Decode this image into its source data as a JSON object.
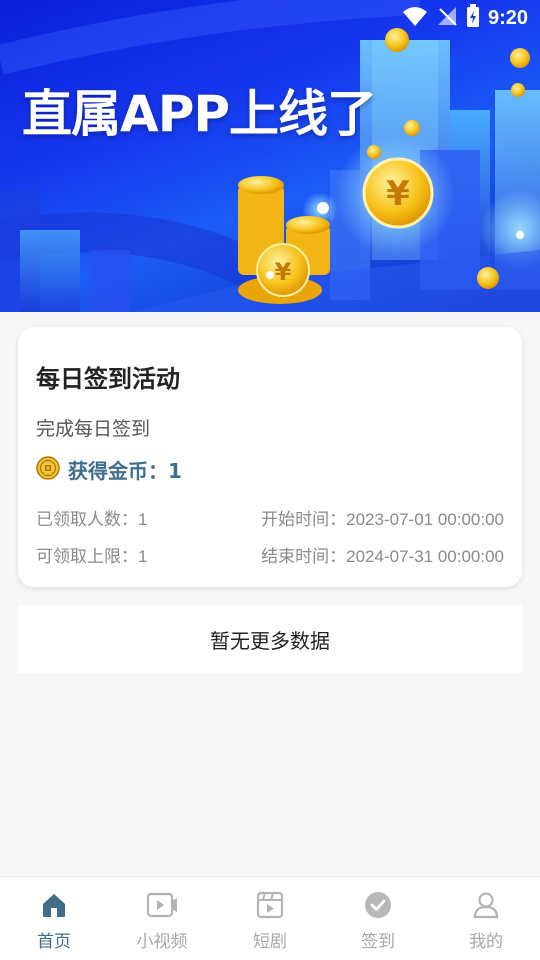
{
  "status_bar": {
    "time": "9:20"
  },
  "banner": {
    "title": "直属APP上线了"
  },
  "activity_card": {
    "title": "每日签到活动",
    "description": "完成每日签到",
    "reward": "获得金币：1",
    "claimed_count": "已领取人数：1",
    "claim_limit": "可领取上限：1",
    "start_time": "开始时间：2023-07-01 00:00:00",
    "end_time": "结束时间：2024-07-31 00:00:00"
  },
  "list_footer": {
    "text": "暂无更多数据"
  },
  "bottom_nav": {
    "items": [
      {
        "label": "首页",
        "icon": "home-icon",
        "active": true
      },
      {
        "label": "小视频",
        "icon": "video-icon",
        "active": false
      },
      {
        "label": "短剧",
        "icon": "film-icon",
        "active": false
      },
      {
        "label": "签到",
        "icon": "check-circle-icon",
        "active": false
      },
      {
        "label": "我的",
        "icon": "person-icon",
        "active": false
      }
    ]
  },
  "colors": {
    "accent": "#3f6d8a",
    "inactive": "#a8a8a8",
    "banner_blue": "#1537ee",
    "coin_gold": "#f5b400"
  }
}
